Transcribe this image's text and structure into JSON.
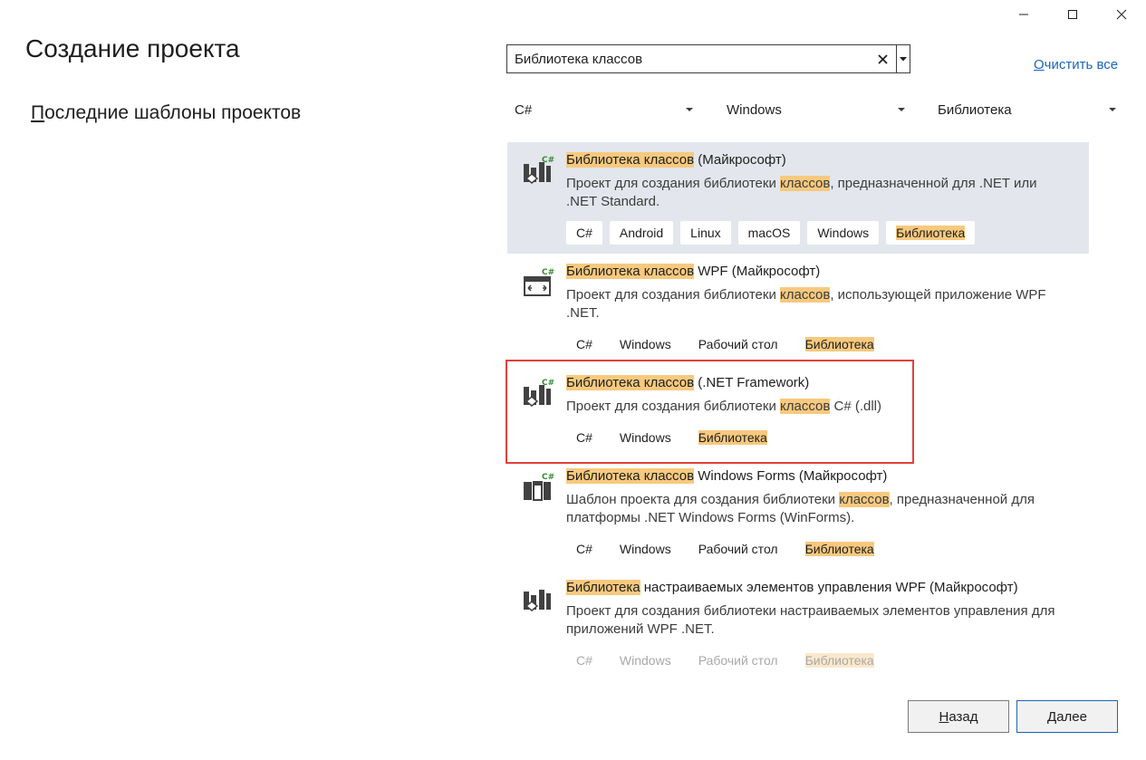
{
  "window": {
    "minimize_label": "",
    "maximize_label": "",
    "close_label": ""
  },
  "header": {
    "title": "Создание проекта"
  },
  "recent": {
    "title_prefix": "П",
    "title_rest": "оследние шаблоны проектов"
  },
  "search": {
    "value": "Библиотека классов",
    "placeholder": ""
  },
  "clear_all": {
    "prefix": "О",
    "rest": "чистить все"
  },
  "filters": [
    {
      "label": "C#"
    },
    {
      "label": "Windows"
    },
    {
      "label": "Библиотека"
    }
  ],
  "templates": [
    {
      "name_hl": "Библиотека классов",
      "name_rest": " (Майкрософт)",
      "desc_a": "Проект для создания библиотеки ",
      "desc_hl": "классов",
      "desc_b": ", предназначенной для .NET или .NET Standard.",
      "tags": [
        "C#",
        "Android",
        "Linux",
        "macOS",
        "Windows"
      ],
      "tag_hl": "Библиотека"
    },
    {
      "name_hl": "Библиотека классов",
      "name_rest": " WPF (Майкрософт)",
      "desc_a": "Проект для создания библиотеки ",
      "desc_hl": "классов",
      "desc_b": ", использующей приложение WPF .NET.",
      "tags": [
        "C#",
        "Windows",
        "Рабочий стол"
      ],
      "tag_hl": "Библиотека"
    },
    {
      "name_hl": "Библиотека классов",
      "name_rest": " (.NET Framework)",
      "desc_a": "Проект для создания библиотеки ",
      "desc_hl": "классов",
      "desc_b": " C# (.dll)",
      "tags": [
        "C#",
        "Windows"
      ],
      "tag_hl": "Библиотека"
    },
    {
      "name_hl": "Библиотека классов",
      "name_rest": " Windows Forms (Майкрософт)",
      "desc_a": "Шаблон проекта для создания библиотеки ",
      "desc_hl": "классов",
      "desc_b": ", предназначенной для платформы .NET Windows Forms (WinForms).",
      "tags": [
        "C#",
        "Windows",
        "Рабочий стол"
      ],
      "tag_hl": "Библиотека"
    },
    {
      "name_hl": "Библиотека",
      "name_rest": " настраиваемых элементов управления WPF (Майкрософт)",
      "desc_a": "Проект для создания библиотеки настраиваемых элементов управления для приложений WPF .NET.",
      "desc_hl": "",
      "desc_b": "",
      "tags": [
        "C#",
        "Windows",
        "Рабочий стол"
      ],
      "tag_hl": "Библиотека"
    }
  ],
  "buttons": {
    "back_prefix": "Н",
    "back_rest": "азад",
    "next_prefix": "Д",
    "next_rest": "алее"
  },
  "colors": {
    "highlight": "#f7c97e",
    "selected_bg": "#e3e6ec",
    "frame": "#e2403c",
    "link": "#1a66b7"
  }
}
